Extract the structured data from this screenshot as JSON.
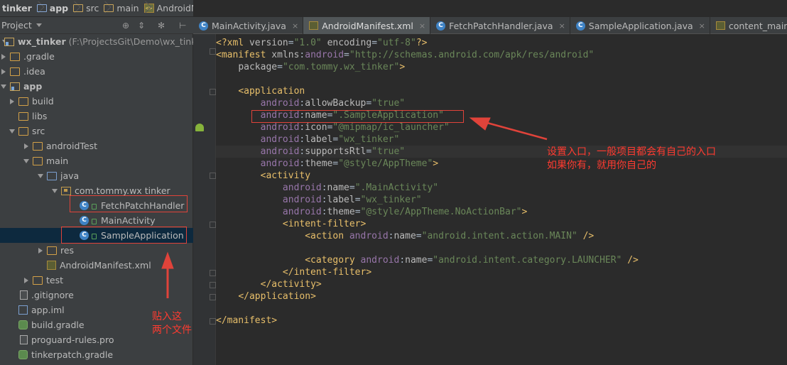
{
  "breadcrumbs": [
    "tinker",
    "app",
    "src",
    "main",
    "AndroidManifest.xml"
  ],
  "project_panel": {
    "title": "Project",
    "tree": [
      {
        "label": "wx_tinker",
        "hint": "(F:\\ProjectsGit\\Demo\\wx_tinker)",
        "icon": "module-icon",
        "arrow": "down",
        "indent": 0,
        "bold": true
      },
      {
        "label": ".gradle",
        "icon": "folder-icon",
        "arrow": "right",
        "indent": 1
      },
      {
        "label": ".idea",
        "icon": "folder-icon",
        "arrow": "right",
        "indent": 1
      },
      {
        "label": "app",
        "icon": "module-folder-icon",
        "arrow": "down",
        "indent": 1,
        "bold": true
      },
      {
        "label": "build",
        "icon": "folder-icon",
        "arrow": "right",
        "indent": 2
      },
      {
        "label": "libs",
        "icon": "folder-icon",
        "arrow": "none",
        "indent": 2
      },
      {
        "label": "src",
        "icon": "folder-icon",
        "arrow": "down",
        "indent": 2
      },
      {
        "label": "androidTest",
        "icon": "folder-icon",
        "arrow": "right",
        "indent": 3
      },
      {
        "label": "main",
        "icon": "folder-icon",
        "arrow": "down",
        "indent": 3
      },
      {
        "label": "java",
        "icon": "source-folder-icon",
        "arrow": "down",
        "indent": 4
      },
      {
        "label": "com.tommy.wx tinker",
        "icon": "package-icon",
        "arrow": "down",
        "indent": 5
      },
      {
        "label": "FetchPatchHandler",
        "icon": "class-icon",
        "arrow": "none",
        "indent": 6
      },
      {
        "label": "MainActivity",
        "icon": "class-icon",
        "arrow": "none",
        "indent": 6
      },
      {
        "label": "SampleApplication",
        "icon": "class-icon",
        "arrow": "none",
        "indent": 6,
        "selected": true
      },
      {
        "label": "res",
        "icon": "resource-folder-icon",
        "arrow": "right",
        "indent": 4
      },
      {
        "label": "AndroidManifest.xml",
        "icon": "xml-file-icon",
        "arrow": "none",
        "indent": 4
      },
      {
        "label": "test",
        "icon": "folder-icon",
        "arrow": "right",
        "indent": 3
      },
      {
        "label": ".gitignore",
        "icon": "file-icon",
        "arrow": "none",
        "indent": 2
      },
      {
        "label": "app.iml",
        "icon": "iml-file-icon",
        "arrow": "none",
        "indent": 2
      },
      {
        "label": "build.gradle",
        "icon": "gradle-file-icon",
        "arrow": "none",
        "indent": 2
      },
      {
        "label": "proguard-rules.pro",
        "icon": "file-icon",
        "arrow": "none",
        "indent": 2
      },
      {
        "label": "tinkerpatch.gradle",
        "icon": "gradle-file-icon",
        "arrow": "none",
        "indent": 2
      }
    ]
  },
  "tabs": [
    {
      "label": "MainActivity.java",
      "icon": "java-class-icon",
      "active": false
    },
    {
      "label": "AndroidManifest.xml",
      "icon": "xml-file-icon",
      "active": true
    },
    {
      "label": "FetchPatchHandler.java",
      "icon": "java-class-icon",
      "active": false
    },
    {
      "label": "SampleApplication.java",
      "icon": "java-class-icon",
      "active": false
    },
    {
      "label": "content_main.xml",
      "icon": "xml-file-icon",
      "active": false
    }
  ],
  "code_lines": [
    "<?xml version=\"1.0\" encoding=\"utf-8\"?>",
    "<manifest xmlns:android=\"http://schemas.android.com/apk/res/android\"",
    "    package=\"com.tommy.wx_tinker\">",
    "",
    "    <application",
    "        android:allowBackup=\"true\"",
    "        android:name=\".SampleApplication\"",
    "        android:icon=\"@mipmap/ic_launcher\"",
    "        android:label=\"wx_tinker\"",
    "        android:supportsRtl=\"true\"",
    "        android:theme=\"@style/AppTheme\">",
    "        <activity",
    "            android:name=\".MainActivity\"",
    "            android:label=\"wx_tinker\"",
    "            android:theme=\"@style/AppTheme.NoActionBar\">",
    "            <intent-filter>",
    "                <action android:name=\"android.intent.action.MAIN\" />",
    "",
    "                <category android:name=\"android.intent.category.LAUNCHER\" />",
    "            </intent-filter>",
    "        </activity>",
    "    </application>",
    "",
    "</manifest>"
  ],
  "annotations": {
    "right_note": "设置入口，一般项目都会有自己的入口\n如果你有，就用你自己的",
    "left_note": "贴入这\n两个文件"
  },
  "colors": {
    "annotation_red": "#e0433a",
    "tag": "#e8bf6a",
    "namespace": "#9876aa",
    "string": "#6a8759"
  }
}
